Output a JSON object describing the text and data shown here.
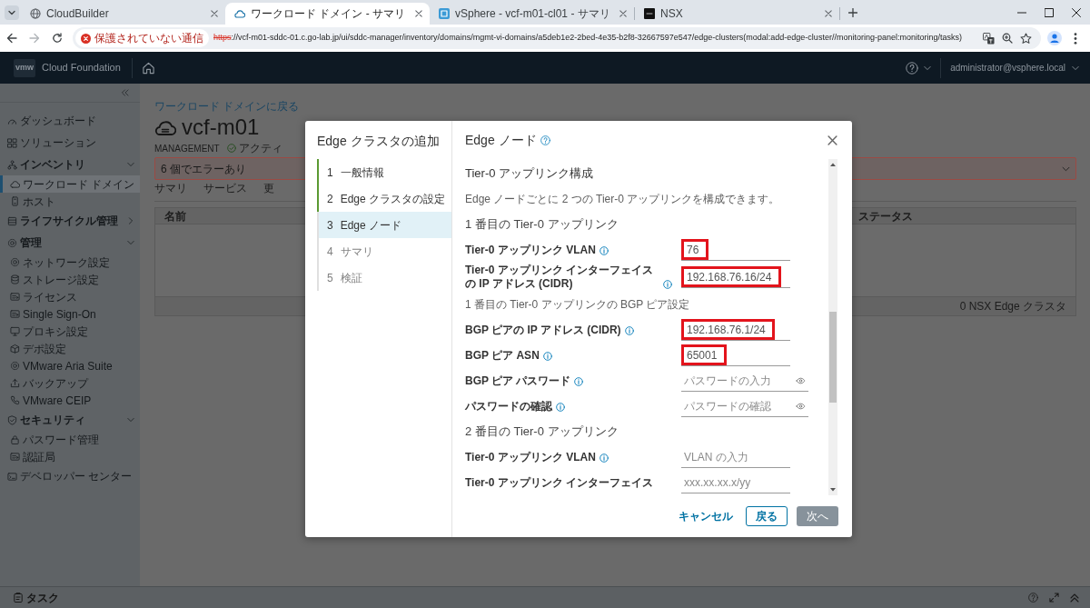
{
  "browser": {
    "tabs": [
      {
        "title": "CloudBuilder",
        "selected": false
      },
      {
        "title": "ワークロード ドメイン - サマリ",
        "selected": true
      },
      {
        "title": "vSphere - vcf-m01-cl01 - サマリ",
        "selected": false
      },
      {
        "title": "NSX",
        "selected": false
      }
    ],
    "security_chip": "保護されていない通信",
    "url_scheme": "https",
    "url_rest": "://vcf-m01-sddc-01.c.go-lab.jp/ui/sddc-manager/inventory/domains/mgmt-vi-domains/a5deb1e2-2bed-4e35-b2f8-32667597e547/edge-clusters(modal:add-edge-cluster//monitoring-panel:monitoring/tasks)"
  },
  "app_header": {
    "logo": "vmw",
    "product": "Cloud Foundation",
    "user": "administrator@vsphere.local"
  },
  "sidebar": {
    "items": [
      {
        "label": "ダッシュボード",
        "selected": false
      },
      {
        "label": "ソリューション",
        "selected": false
      },
      {
        "label": "インベントリ",
        "selected": false,
        "expanded": true,
        "children": [
          {
            "label": "ワークロード ドメイン",
            "selected": true
          },
          {
            "label": "ホスト",
            "selected": false
          }
        ]
      },
      {
        "label": "ライフサイクル管理",
        "selected": false,
        "expanded": false
      },
      {
        "label": "管理",
        "selected": false,
        "expanded": true,
        "children": [
          {
            "label": "ネットワーク設定",
            "selected": false
          },
          {
            "label": "ストレージ設定",
            "selected": false
          },
          {
            "label": "ライセンス",
            "selected": false
          },
          {
            "label": "Single Sign-On",
            "selected": false
          },
          {
            "label": "プロキシ設定",
            "selected": false
          },
          {
            "label": "デポ設定",
            "selected": false
          },
          {
            "label": "VMware Aria Suite",
            "selected": false
          },
          {
            "label": "バックアップ",
            "selected": false
          },
          {
            "label": "VMware CEIP",
            "selected": false
          }
        ]
      },
      {
        "label": "セキュリティ",
        "selected": false,
        "expanded": true,
        "children": [
          {
            "label": "パスワード管理",
            "selected": false
          },
          {
            "label": "認証局",
            "selected": false
          }
        ]
      },
      {
        "label": "デベロッパー センター",
        "selected": false
      }
    ]
  },
  "page": {
    "back_link": "ワークロード ドメインに戻る",
    "title": "vcf-m01",
    "domain_type": "MANAGEMENT",
    "status": "アクティ",
    "error_banner": "6 個でエラーあり",
    "tabs": [
      {
        "label": "サマリ",
        "selected": false
      },
      {
        "label": "サービス",
        "selected": false
      },
      {
        "label": "更",
        "selected": false
      }
    ],
    "table": {
      "columns": [
        "名前",
        "ステータス"
      ],
      "footer": "0 NSX Edge クラスタ"
    }
  },
  "dialog": {
    "title": "Edge クラスタの追加",
    "steps": [
      {
        "number": "1",
        "label": "一般情報",
        "completed": true,
        "selected": false
      },
      {
        "number": "2",
        "label": "Edge クラスタの設定",
        "completed": true,
        "selected": false
      },
      {
        "number": "3",
        "label": "Edge ノード",
        "completed": false,
        "selected": true
      },
      {
        "number": "4",
        "label": "サマリ",
        "completed": false,
        "selected": false
      },
      {
        "number": "5",
        "label": "検証",
        "completed": false,
        "selected": false
      }
    ],
    "panel_title": "Edge ノード",
    "form": [
      {
        "kind": "section",
        "text": "Tier-0 アップリンク構成"
      },
      {
        "kind": "note",
        "text": "Edge ノードごとに 2 つの Tier-0 アップリンクを構成できます。"
      },
      {
        "kind": "heading",
        "text": "1 番目の Tier-0 アップリンク"
      },
      {
        "kind": "field",
        "label": "Tier-0 アップリンク VLAN",
        "info": true,
        "value": "76",
        "highlighted": true
      },
      {
        "kind": "field",
        "label": "Tier-0 アップリンク インターフェイスの IP アドレス (CIDR)",
        "info": true,
        "value": "192.168.76.16/24",
        "highlighted": true
      },
      {
        "kind": "note",
        "text": "1 番目の Tier-0 アップリンクの BGP ピア設定"
      },
      {
        "kind": "field",
        "label": "BGP ピアの IP アドレス (CIDR)",
        "info": true,
        "value": "192.168.76.1/24",
        "highlighted": true
      },
      {
        "kind": "field",
        "label": "BGP ピア ASN",
        "info": true,
        "value": "65001",
        "highlighted": true
      },
      {
        "kind": "password",
        "label": "BGP ピア パスワード",
        "info": true,
        "placeholder": "パスワードの入力",
        "highlighted": false
      },
      {
        "kind": "password",
        "label": "パスワードの確認",
        "info": true,
        "placeholder": "パスワードの確認",
        "highlighted": false
      },
      {
        "kind": "heading",
        "text": "2 番目の Tier-0 アップリンク"
      },
      {
        "kind": "field",
        "label": "Tier-0 アップリンク VLAN",
        "info": true,
        "placeholder": "VLAN の入力",
        "highlighted": false
      },
      {
        "kind": "field",
        "label": "Tier-0 アップリンク インターフェイス",
        "info": false,
        "placeholder": "xxx.xx.xx.x/yy",
        "highlighted": false
      }
    ],
    "buttons": [
      {
        "label": "キャンセル",
        "kind": "link",
        "disabled": false
      },
      {
        "label": "戻る",
        "kind": "outline",
        "disabled": false
      },
      {
        "label": "次へ",
        "kind": "primary",
        "disabled": true
      }
    ]
  },
  "task_bar": {
    "label": "タスク"
  }
}
